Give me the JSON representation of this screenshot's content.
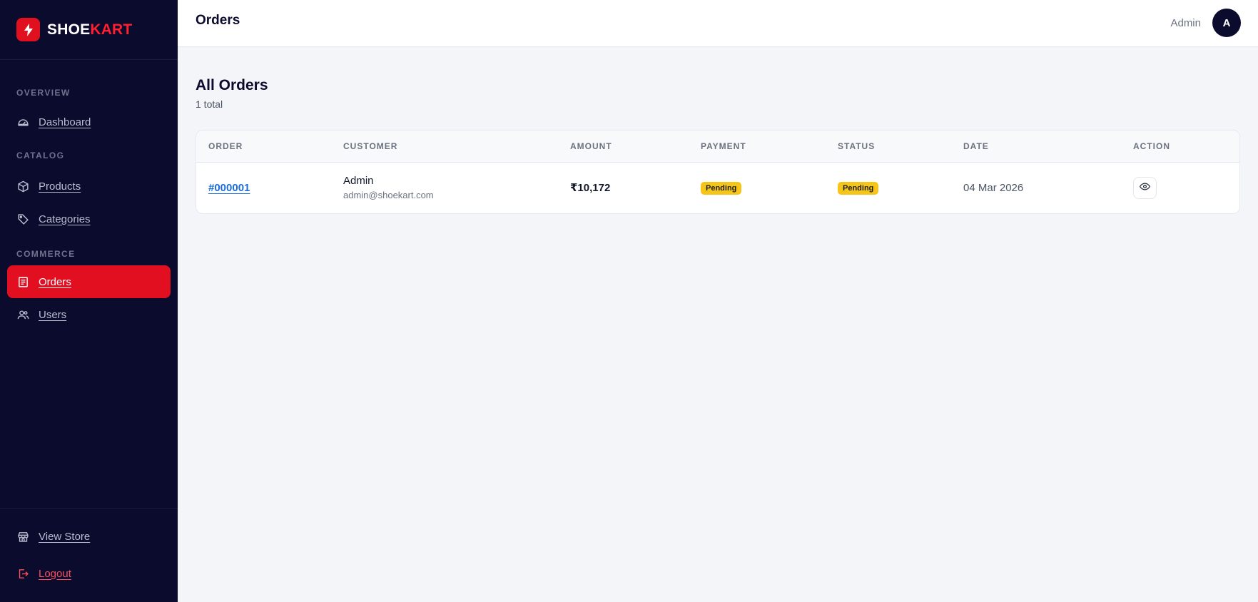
{
  "brand": {
    "name_part1": "SHOE",
    "name_part2": "KART",
    "logo_icon": "bolt-icon",
    "accent": "#e20f20"
  },
  "sidebar": {
    "sections": [
      {
        "title": "OVERVIEW",
        "items": [
          {
            "label": "Dashboard",
            "icon": "gauge-icon"
          }
        ]
      },
      {
        "title": "CATALOG",
        "items": [
          {
            "label": "Products",
            "icon": "box-icon"
          },
          {
            "label": "Categories",
            "icon": "tag-icon"
          }
        ]
      },
      {
        "title": "COMMERCE",
        "items": [
          {
            "label": "Orders",
            "icon": "receipt-icon",
            "active": true
          },
          {
            "label": "Users",
            "icon": "users-icon"
          }
        ]
      }
    ],
    "bottom": [
      {
        "label": "View Store",
        "icon": "store-icon"
      },
      {
        "label": "Logout",
        "icon": "logout-icon"
      }
    ]
  },
  "topbar": {
    "title": "Orders",
    "user_name": "Admin",
    "avatar_initial": "A"
  },
  "page": {
    "title": "All Orders",
    "subtitle": "1 total"
  },
  "table": {
    "headers": [
      "ORDER",
      "CUSTOMER",
      "AMOUNT",
      "PAYMENT",
      "STATUS",
      "DATE",
      "ACTION"
    ],
    "rows": [
      {
        "order_id": "#000001",
        "customer_name": "Admin",
        "customer_email": "admin@shoekart.com",
        "amount": "₹10,172",
        "payment": "Pending",
        "status": "Pending",
        "date": "04 Mar 2026",
        "action_icon": "eye-icon"
      }
    ]
  },
  "colors": {
    "sidebar_bg": "#0b0b2d",
    "badge_pending": "#f5c518",
    "link": "#1d6fd6"
  }
}
